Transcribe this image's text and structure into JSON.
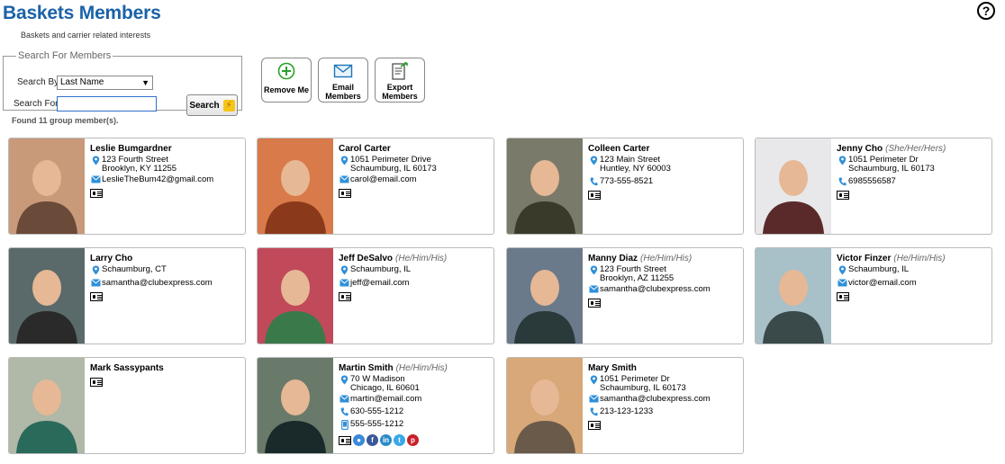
{
  "header": {
    "title": "Baskets Members",
    "subtitle": "Baskets and carrier related interests",
    "help_symbol": "?"
  },
  "search": {
    "legend": "Search For Members",
    "search_by_label": "Search By",
    "search_by_value": "Last Name",
    "search_for_label": "Search For",
    "search_for_value": "",
    "button_label": "Search"
  },
  "actions": {
    "remove_me": "Remove Me",
    "email_members_line1": "Email",
    "email_members_line2": "Members",
    "export_members_line1": "Export",
    "export_members_line2": "Members"
  },
  "found_text": "Found 11 group member(s).",
  "colors": {
    "title": "#1a62a8",
    "icon_blue": "#2f8fd8",
    "add_green": "#2aa12a"
  },
  "members": [
    {
      "name": "Leslie Bumgardner",
      "pronouns": "",
      "address1": "123 Fourth Street",
      "address2": "Brooklyn, KY 11255",
      "email": "LeslieTheBum42@gmail.com",
      "phone": "",
      "mobile": ""
    },
    {
      "name": "Carol Carter",
      "pronouns": "",
      "address1": "1051 Perimeter Drive",
      "address2": "Schaumburg, IL 60173",
      "email": "carol@email.com",
      "phone": "",
      "mobile": ""
    },
    {
      "name": "Colleen Carter",
      "pronouns": "",
      "address1": "123 Main Street",
      "address2": "Huntley, NY 60003",
      "email": "",
      "phone": "773-555-8521",
      "mobile": ""
    },
    {
      "name": "Jenny Cho",
      "pronouns": "(She/Her/Hers)",
      "address1": "1051 Perimeter Dr",
      "address2": "Schaumburg, IL 60173",
      "email": "",
      "phone": "6985556587",
      "mobile": ""
    },
    {
      "name": "Larry Cho",
      "pronouns": "",
      "address1": "Schaumburg, CT",
      "address2": "",
      "email": "samantha@clubexpress.com",
      "phone": "",
      "mobile": ""
    },
    {
      "name": "Jeff DeSalvo",
      "pronouns": "(He/Him/His)",
      "address1": "Schaumburg, IL",
      "address2": "",
      "email": "jeff@email.com",
      "phone": "",
      "mobile": ""
    },
    {
      "name": "Manny Diaz",
      "pronouns": "(He/Him/His)",
      "address1": "123 Fourth Street",
      "address2": "Brooklyn, AZ 11255",
      "email": "samantha@clubexpress.com",
      "phone": "",
      "mobile": ""
    },
    {
      "name": "Victor Finzer",
      "pronouns": "(He/Him/His)",
      "address1": "Schaumburg, IL",
      "address2": "",
      "email": "victor@email.com",
      "phone": "",
      "mobile": ""
    },
    {
      "name": "Mark Sassypants",
      "pronouns": "",
      "address1": "",
      "address2": "",
      "email": "",
      "phone": "",
      "mobile": ""
    },
    {
      "name": "Martin Smith",
      "pronouns": "(He/Him/His)",
      "address1": "70 W Madison",
      "address2": "Chicago, IL 60601",
      "email": "martin@email.com",
      "phone": "630-555-1212",
      "mobile": "555-555-1212"
    },
    {
      "name": "Mary Smith",
      "pronouns": "",
      "address1": "1051 Perimeter Dr",
      "address2": "Schaumburg, IL 60173",
      "email": "samantha@clubexpress.com",
      "phone": "213-123-1233",
      "mobile": ""
    }
  ]
}
